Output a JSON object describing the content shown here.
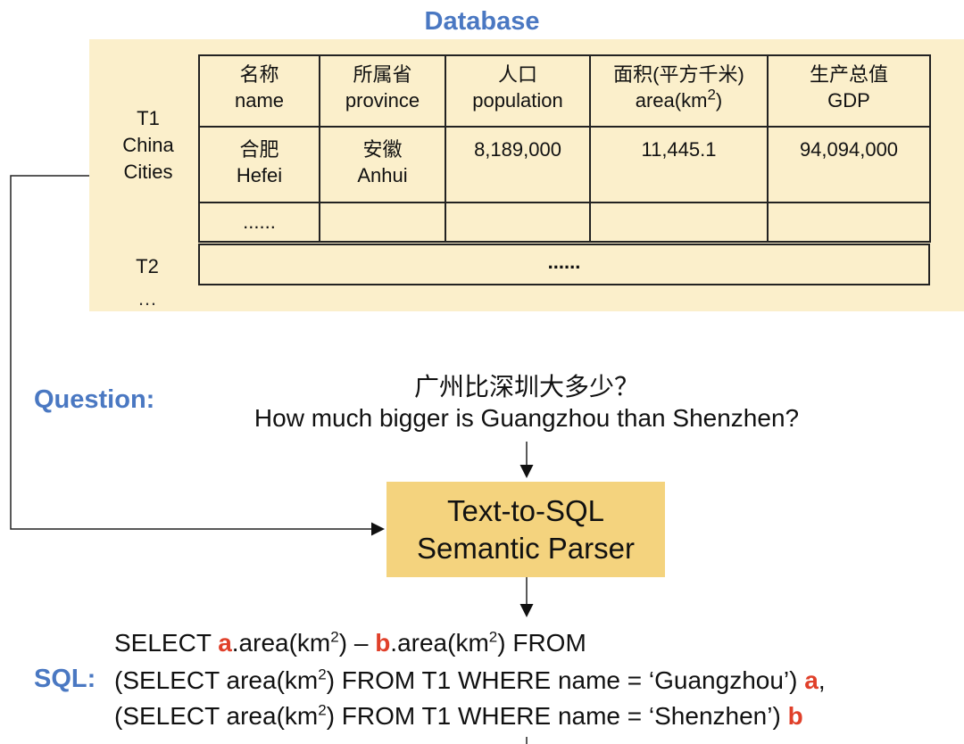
{
  "database": {
    "title": "Database",
    "t1_label": [
      "T1",
      "China",
      "Cities"
    ],
    "t1_headers": [
      {
        "zh": "名称",
        "en": "name"
      },
      {
        "zh": "所属省",
        "en": "province"
      },
      {
        "zh": "人口",
        "en": "population"
      },
      {
        "zh": "面积(平方千米)",
        "en": "area(km",
        "sup": "2",
        "en_tail": ")"
      },
      {
        "zh": "生产总值",
        "en": "GDP"
      }
    ],
    "t1_row": {
      "name_zh": "合肥",
      "name_en": "Hefei",
      "province_zh": "安徽",
      "province_en": "Anhui",
      "population": "8,189,000",
      "area": "11,445.1",
      "gdp": "94,094,000"
    },
    "t1_more": "......",
    "t2_label": "T2",
    "t2_content": "......",
    "more_tables": "…"
  },
  "question": {
    "label": "Question:",
    "zh": "广州比深圳大多少？",
    "en": "How much bigger is Guangzhou than Shenzhen?"
  },
  "parser": {
    "line1": "Text-to-SQL",
    "line2": "Semantic Parser"
  },
  "sql": {
    "label": "SQL:",
    "alias_a": "a",
    "alias_b": "b",
    "line1": {
      "p1": "SELECT ",
      "p2": ".area(km",
      "p3": ") – ",
      "p4": ".area(km",
      "p5": ") FROM"
    },
    "line2": {
      "p1": "(SELECT area(km",
      "p2": ") FROM T1 WHERE name = ‘Guangzhou’) ",
      "p3": ","
    },
    "line3": {
      "p1": "(SELECT area(km",
      "p2": ") FROM T1 WHERE name = ‘Shenzhen’) "
    },
    "superscript": "2"
  }
}
